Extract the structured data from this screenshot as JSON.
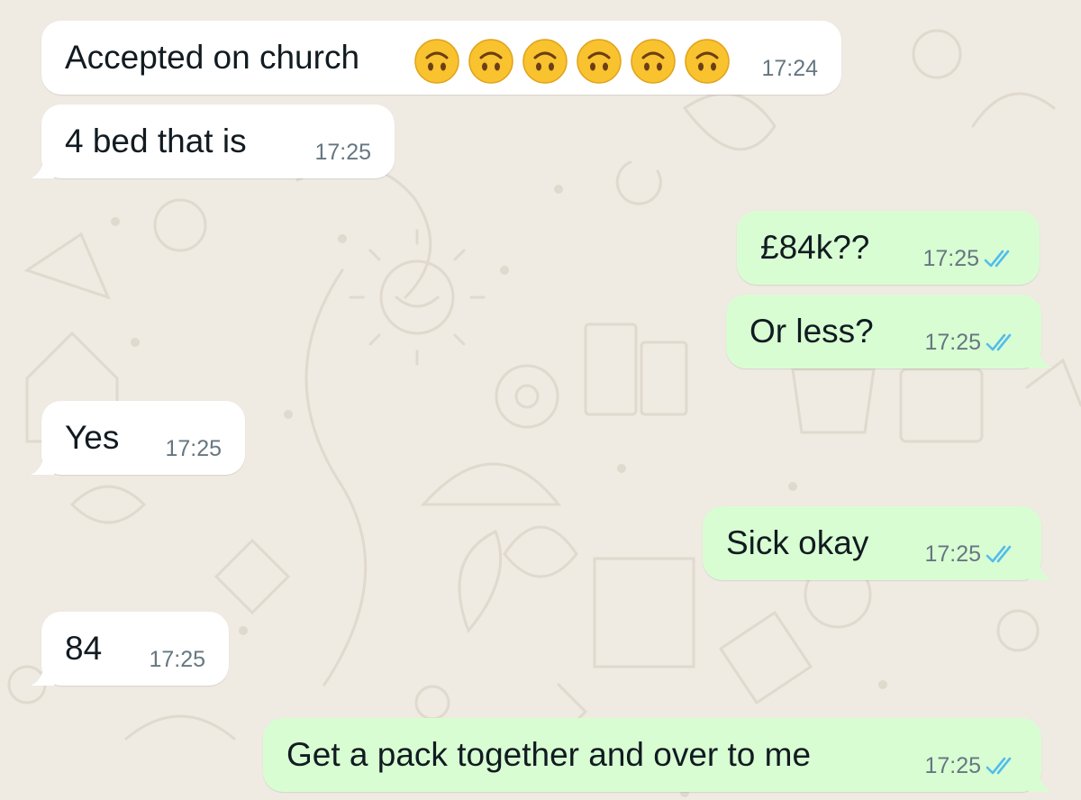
{
  "chat": {
    "colors": {
      "background": "#efeae2",
      "incoming_bubble": "#ffffff",
      "outgoing_bubble": "#d9fdd3",
      "read_ticks": "#53bdeb",
      "timestamp": "#667781"
    },
    "messages": [
      {
        "direction": "incoming",
        "text": "Accepted on church",
        "emoji": [
          "upside-down-face",
          "upside-down-face",
          "upside-down-face",
          "upside-down-face",
          "upside-down-face",
          "upside-down-face"
        ],
        "time": "17:24"
      },
      {
        "direction": "incoming",
        "text": "4 bed that is",
        "time": "17:25"
      },
      {
        "direction": "outgoing",
        "text": "£84k??",
        "time": "17:25",
        "status": "read"
      },
      {
        "direction": "outgoing",
        "text": "Or less?",
        "time": "17:25",
        "status": "read"
      },
      {
        "direction": "incoming",
        "text": "Yes",
        "time": "17:25"
      },
      {
        "direction": "outgoing",
        "text": "Sick okay",
        "time": "17:25",
        "status": "read"
      },
      {
        "direction": "incoming",
        "text": "84",
        "time": "17:25"
      },
      {
        "direction": "outgoing",
        "text": "Get a pack together and over to me",
        "time": "17:25",
        "status": "read"
      }
    ]
  }
}
